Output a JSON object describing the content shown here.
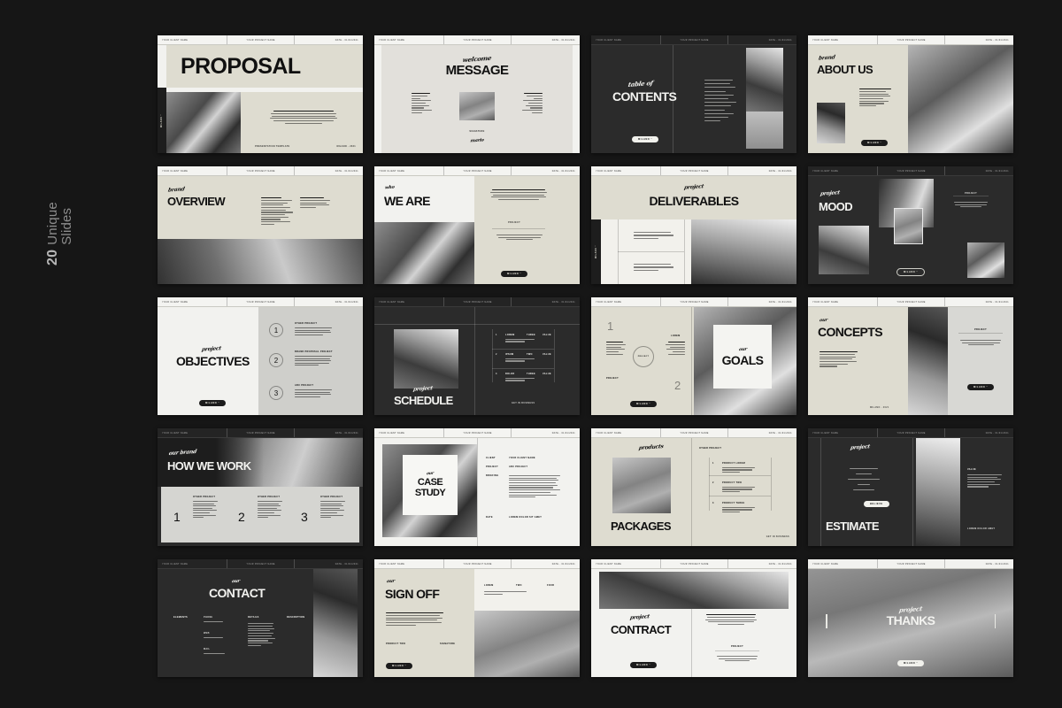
{
  "caption": {
    "number": "20",
    "text": "Unique\nSlides"
  },
  "colors": {
    "background": "#161616",
    "cream": "#dedcd0",
    "white": "#f2f2ef",
    "dark": "#2b2b2b",
    "black": "#1d1d1d",
    "ink": "#101010"
  },
  "header": {
    "client": "YOUR CLIENT NAME",
    "project": "YOUR PROJECT NAME",
    "date": "DATE - 01/01/2021"
  },
  "brand": {
    "logo": "MILANO",
    "logo_mark": "MILANO °"
  },
  "body_copy": "LOREM IPSUM IS SIMPLY DUMMY TEXT OF THE PRINTING AND TYPESETTING INDUSTRY. LOREM IPSUM HAS BEEN THE INDUSTRY'S STANDARD DUMMY TEXT EVER SINCE THE 1500S, WHEN AN UNKNOWN PRINTER TOOK A GALLEY OF",
  "slides": [
    {
      "n": 1,
      "kicker": "",
      "title": "PROPOSAL",
      "footer_left": "PRESENTATION TEMPLATE",
      "footer_right": "MILANO  -  2021",
      "theme": "cream"
    },
    {
      "n": 2,
      "kicker": "welcome",
      "title": "MESSAGE",
      "footer_left": "SIGNATURE",
      "footer_right": "mario",
      "theme": "white"
    },
    {
      "n": 3,
      "kicker": "table of",
      "title": "CONTENTS",
      "footer_left": "",
      "footer_right": "",
      "theme": "dark"
    },
    {
      "n": 4,
      "kicker": "brand",
      "title": "ABOUT US",
      "footer_left": "",
      "footer_right": "",
      "theme": "cream"
    },
    {
      "n": 5,
      "kicker": "brand",
      "title": "OVERVIEW",
      "footer_left": "",
      "footer_right": "",
      "theme": "cream"
    },
    {
      "n": 6,
      "kicker": "who",
      "title": "WE ARE",
      "footer_left": "",
      "footer_right": "",
      "theme": "white"
    },
    {
      "n": 7,
      "kicker": "project",
      "title": "DELIVERABLES",
      "footer_left": "",
      "footer_right": "",
      "theme": "cream"
    },
    {
      "n": 8,
      "kicker": "project",
      "title": "MOOD",
      "footer_left": "",
      "footer_right": "",
      "theme": "dark"
    },
    {
      "n": 9,
      "kicker": "project",
      "title": "OBJECTIVES",
      "footer_left": "",
      "footer_right": "",
      "theme": "white"
    },
    {
      "n": 10,
      "kicker": "project",
      "title": "SCHEDULE",
      "footer_left": "",
      "footer_right": "GET IN BUSINESS",
      "theme": "dark"
    },
    {
      "n": 11,
      "kicker": "our",
      "title": "GOALS",
      "footer_left": "",
      "footer_right": "",
      "theme": "cream"
    },
    {
      "n": 12,
      "kicker": "our",
      "title": "CONCEPTS",
      "footer_left": "",
      "footer_right": "MILANO  -  2021",
      "theme": "cream"
    },
    {
      "n": 13,
      "kicker": "our brand",
      "title": "HOW WE WORK",
      "footer_left": "",
      "footer_right": "",
      "theme": "dark"
    },
    {
      "n": 14,
      "kicker": "our",
      "title": "CASE STUDY",
      "footer_left": "",
      "footer_right": "",
      "theme": "white"
    },
    {
      "n": 15,
      "kicker": "products",
      "title": "PACKAGES",
      "footer_left": "",
      "footer_right": "GET IN BUSINESS",
      "theme": "cream"
    },
    {
      "n": 16,
      "kicker": "project",
      "title": "ESTIMATE",
      "footer_left": "",
      "footer_right": "",
      "theme": "dark"
    },
    {
      "n": 17,
      "kicker": "our",
      "title": "CONTACT",
      "footer_left": "",
      "footer_right": "",
      "theme": "dark"
    },
    {
      "n": 18,
      "kicker": "our",
      "title": "SIGN OFF",
      "footer_left": "PRODUCT TWO",
      "footer_right": "SIGNATURE",
      "theme": "cream"
    },
    {
      "n": 19,
      "kicker": "project",
      "title": "CONTRACT",
      "footer_left": "",
      "footer_right": "",
      "theme": "white"
    },
    {
      "n": 20,
      "kicker": "project",
      "title": "THANKS",
      "footer_left": "",
      "footer_right": "",
      "theme": "photo"
    }
  ],
  "slide2": {
    "col_left_head": "LOREM IPSUM 1",
    "col_right_head": "LOREM IPSUM 2",
    "signature_label": "SIGNATURE",
    "signature": "mario"
  },
  "slide3": {
    "items": [
      "LOREM IPSUM 01",
      "LOREM IPSUM TEXT",
      "OF THE PRINTING AND",
      "TYPESETTING",
      "INDUSTRY - LOREM",
      "IPSUM HAS BEEN THE",
      "INDUSTRY'S STANDARD",
      "DUMMY TEXT EVER",
      "SINCE THE 1500S",
      "WHEN AN UNKNOWN",
      "PRINTER TOOK A",
      "GALLEY OF"
    ]
  },
  "slide7": {
    "items_a": [
      "LOREM IPSUM IS SIMPLY",
      "TEXT INDUSTRY'S STANDARD",
      "LOCAL DESIGN ABC"
    ],
    "items_b": [
      "LOREM IPSUM IS SIMPLY",
      "TEXT INDUSTRY'S STANDARD",
      "LOCAL DESIGN ABC"
    ],
    "tab_a": "LOREM",
    "tab_b": "IPSUM"
  },
  "slide9": {
    "steps": [
      {
        "num": "1",
        "head": "OTHER PROJECT"
      },
      {
        "num": "2",
        "head": "BRAND PROPOSAL PROJECT"
      },
      {
        "num": "3",
        "head": "ABC PROJECT"
      }
    ]
  },
  "slide10": {
    "rows": [
      {
        "n": "1",
        "a": "LOREM",
        "b": "THREE",
        "c": "VALUE"
      },
      {
        "n": "2",
        "a": "IPSUM",
        "b": "TWO",
        "c": "VALUE"
      },
      {
        "n": "3",
        "a": "DOLOR",
        "b": "THREE",
        "c": "VALUE"
      }
    ]
  },
  "slide11": {
    "nums": [
      "1",
      "2"
    ],
    "badge": "PROJECT",
    "head_right": "LOREM"
  },
  "slide13": {
    "steps": [
      {
        "num": "1",
        "head": "OTHER PROJECT"
      },
      {
        "num": "2",
        "head": "OTHER PROJECT"
      },
      {
        "num": "3",
        "head": "OTHER PROJECT"
      }
    ]
  },
  "slide14": {
    "fields": [
      {
        "label": "CLIENT",
        "value": "YOUR CLIENT NAME"
      },
      {
        "label": "PROJECT",
        "value": "ABC PROJECT"
      },
      {
        "label": "BRIEFING",
        "value": ""
      },
      {
        "label": "DATE",
        "value": "LOREM DOLOR SIT AMET"
      }
    ]
  },
  "slide15": {
    "section": "OTHER PROJECT",
    "items": [
      {
        "n": "1",
        "head": "PRODUCT LOREM"
      },
      {
        "n": "2",
        "head": "PRODUCT TWO"
      },
      {
        "n": "3",
        "head": "PRODUCT THREE"
      }
    ]
  },
  "slide16": {
    "list": [
      "LOREM IPSUM",
      "LOREM",
      "TEXT STANDARD",
      "ABC",
      "LOREM"
    ],
    "cta": "BELIEVE",
    "right_head": "VALUE",
    "footer": "LOREM DOLOR AMET"
  },
  "slide17": {
    "cols": [
      {
        "head": "ELEMENTS"
      },
      {
        "head": "PHONE"
      },
      {
        "head": "DETAILS"
      },
      {
        "head": "DESCRIPTION"
      }
    ],
    "sub": [
      "WEB",
      "MAIL"
    ]
  },
  "slide18": {
    "fields": [
      {
        "label": "LOREM"
      },
      {
        "label": "TWO"
      },
      {
        "label": "FOUR"
      }
    ]
  },
  "slide19": {
    "badge": "PROJECT"
  }
}
